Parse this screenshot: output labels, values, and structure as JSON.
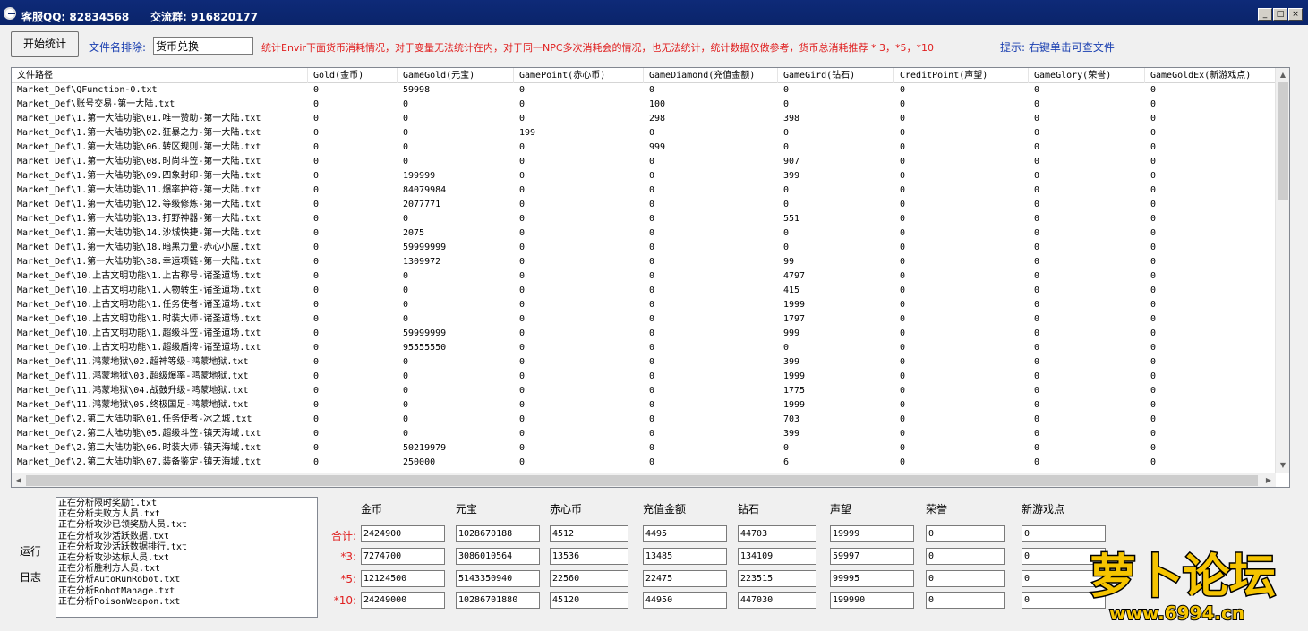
{
  "window": {
    "title_left": "客服QQ: 82834568",
    "title_right": "交流群: 916820177",
    "min_label": "_",
    "max_label": "□",
    "close_label": "×"
  },
  "toolbar": {
    "start_button": "开始统计",
    "exclude_label": "文件名排除:",
    "exclude_value": "货币兑换",
    "notice": "统计Envir下面货币消耗情况，对于变量无法统计在内，对于同一NPC多次消耗会的情况，也无法统计，统计数据仅做参考，货币总消耗推荐 * 3，*5，*10",
    "hint": "提示: 右键单击可查文件"
  },
  "table": {
    "columns": [
      "文件路径",
      "Gold(金币)",
      "GameGold(元宝)",
      "GamePoint(赤心币)",
      "GameDiamond(充值金额)",
      "GameGird(钻石)",
      "CreditPoint(声望)",
      "GameGlory(荣誉)",
      "GameGoldEx(新游戏点)"
    ],
    "rows": [
      [
        "Market_Def\\QFunction-0.txt",
        "0",
        "59998",
        "0",
        "0",
        "0",
        "0",
        "0",
        "0"
      ],
      [
        "Market_Def\\账号交易-第一大陆.txt",
        "0",
        "0",
        "0",
        "100",
        "0",
        "0",
        "0",
        "0"
      ],
      [
        "Market_Def\\1.第一大陆功能\\01.唯一赞助-第一大陆.txt",
        "0",
        "0",
        "0",
        "298",
        "398",
        "0",
        "0",
        "0"
      ],
      [
        "Market_Def\\1.第一大陆功能\\02.狂暴之力-第一大陆.txt",
        "0",
        "0",
        "199",
        "0",
        "0",
        "0",
        "0",
        "0"
      ],
      [
        "Market_Def\\1.第一大陆功能\\06.转区规则-第一大陆.txt",
        "0",
        "0",
        "0",
        "999",
        "0",
        "0",
        "0",
        "0"
      ],
      [
        "Market_Def\\1.第一大陆功能\\08.时尚斗笠-第一大陆.txt",
        "0",
        "0",
        "0",
        "0",
        "907",
        "0",
        "0",
        "0"
      ],
      [
        "Market_Def\\1.第一大陆功能\\09.四象封印-第一大陆.txt",
        "0",
        "199999",
        "0",
        "0",
        "399",
        "0",
        "0",
        "0"
      ],
      [
        "Market_Def\\1.第一大陆功能\\11.爆率护符-第一大陆.txt",
        "0",
        "84079984",
        "0",
        "0",
        "0",
        "0",
        "0",
        "0"
      ],
      [
        "Market_Def\\1.第一大陆功能\\12.等级修炼-第一大陆.txt",
        "0",
        "2077771",
        "0",
        "0",
        "0",
        "0",
        "0",
        "0"
      ],
      [
        "Market_Def\\1.第一大陆功能\\13.打野神器-第一大陆.txt",
        "0",
        "0",
        "0",
        "0",
        "551",
        "0",
        "0",
        "0"
      ],
      [
        "Market_Def\\1.第一大陆功能\\14.沙城快捷-第一大陆.txt",
        "0",
        "2075",
        "0",
        "0",
        "0",
        "0",
        "0",
        "0"
      ],
      [
        "Market_Def\\1.第一大陆功能\\18.暗黑力量-赤心小屋.txt",
        "0",
        "59999999",
        "0",
        "0",
        "0",
        "0",
        "0",
        "0"
      ],
      [
        "Market_Def\\1.第一大陆功能\\38.幸运项链-第一大陆.txt",
        "0",
        "1309972",
        "0",
        "0",
        "99",
        "0",
        "0",
        "0"
      ],
      [
        "Market_Def\\10.上古文明功能\\1.上古称号-诸圣道场.txt",
        "0",
        "0",
        "0",
        "0",
        "4797",
        "0",
        "0",
        "0"
      ],
      [
        "Market_Def\\10.上古文明功能\\1.人物转生-诸圣道场.txt",
        "0",
        "0",
        "0",
        "0",
        "415",
        "0",
        "0",
        "0"
      ],
      [
        "Market_Def\\10.上古文明功能\\1.任务使者-诸圣道场.txt",
        "0",
        "0",
        "0",
        "0",
        "1999",
        "0",
        "0",
        "0"
      ],
      [
        "Market_Def\\10.上古文明功能\\1.时装大师-诸圣道场.txt",
        "0",
        "0",
        "0",
        "0",
        "1797",
        "0",
        "0",
        "0"
      ],
      [
        "Market_Def\\10.上古文明功能\\1.超级斗笠-诸圣道场.txt",
        "0",
        "59999999",
        "0",
        "0",
        "999",
        "0",
        "0",
        "0"
      ],
      [
        "Market_Def\\10.上古文明功能\\1.超级盾牌-诸圣道场.txt",
        "0",
        "95555550",
        "0",
        "0",
        "0",
        "0",
        "0",
        "0"
      ],
      [
        "Market_Def\\11.鸿蒙地狱\\02.超神等级-鸿蒙地狱.txt",
        "0",
        "0",
        "0",
        "0",
        "399",
        "0",
        "0",
        "0"
      ],
      [
        "Market_Def\\11.鸿蒙地狱\\03.超级爆率-鸿蒙地狱.txt",
        "0",
        "0",
        "0",
        "0",
        "1999",
        "0",
        "0",
        "0"
      ],
      [
        "Market_Def\\11.鸿蒙地狱\\04.战鼓升级-鸿蒙地狱.txt",
        "0",
        "0",
        "0",
        "0",
        "1775",
        "0",
        "0",
        "0"
      ],
      [
        "Market_Def\\11.鸿蒙地狱\\05.终极国足-鸿蒙地狱.txt",
        "0",
        "0",
        "0",
        "0",
        "1999",
        "0",
        "0",
        "0"
      ],
      [
        "Market_Def\\2.第二大陆功能\\01.任务使者-冰之城.txt",
        "0",
        "0",
        "0",
        "0",
        "703",
        "0",
        "0",
        "0"
      ],
      [
        "Market_Def\\2.第二大陆功能\\05.超级斗笠-镇天海域.txt",
        "0",
        "0",
        "0",
        "0",
        "399",
        "0",
        "0",
        "0"
      ],
      [
        "Market_Def\\2.第二大陆功能\\06.时装大师-镇天海域.txt",
        "0",
        "50219979",
        "0",
        "0",
        "0",
        "0",
        "0",
        "0"
      ],
      [
        "Market_Def\\2.第二大陆功能\\07.装备鉴定-镇天海域.txt",
        "0",
        "250000",
        "0",
        "0",
        "6",
        "0",
        "0",
        "0"
      ]
    ]
  },
  "log": {
    "label_top": "运行",
    "label_bottom": "日志",
    "lines": [
      "正在分析限时奖励1.txt",
      "正在分析夫败方人员.txt",
      "正在分析攻沙已领奖励人员.txt",
      "正在分析攻沙活跃数据.txt",
      "正在分析攻沙活跃数据排行.txt",
      "正在分析攻沙达标人员.txt",
      "正在分析胜利方人员.txt",
      "正在分析AutoRunRobot.txt",
      "正在分析RobotManage.txt",
      "正在分析PoisonWeapon.txt"
    ]
  },
  "summary": {
    "headers": [
      "金币",
      "元宝",
      "赤心币",
      "充值金额",
      "钻石",
      "声望",
      "荣誉",
      "新游戏点"
    ],
    "rows": [
      {
        "label": "合计:",
        "values": [
          "2424900",
          "1028670188",
          "4512",
          "4495",
          "44703",
          "19999",
          "0",
          "0"
        ]
      },
      {
        "label": "*3:",
        "values": [
          "7274700",
          "3086010564",
          "13536",
          "13485",
          "134109",
          "59997",
          "0",
          "0"
        ]
      },
      {
        "label": "*5:",
        "values": [
          "12124500",
          "5143350940",
          "22560",
          "22475",
          "223515",
          "99995",
          "0",
          "0"
        ]
      },
      {
        "label": "*10:",
        "values": [
          "24249000",
          "10286701880",
          "45120",
          "44950",
          "447030",
          "199990",
          "0",
          "0"
        ]
      }
    ]
  },
  "watermark": {
    "logo_text": "萝卜论坛",
    "url": "www.6994.cn"
  }
}
